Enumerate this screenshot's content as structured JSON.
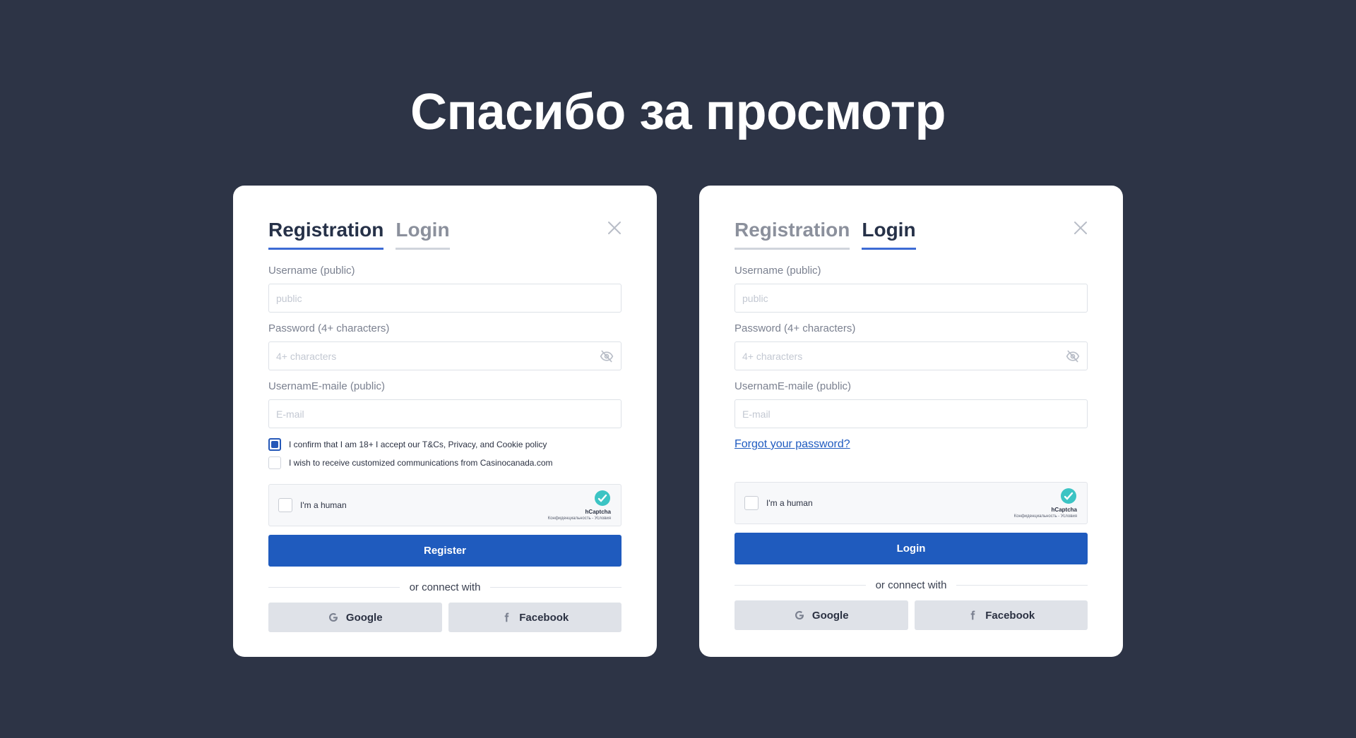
{
  "heading": "Спасибо за просмотр",
  "colors": {
    "background": "#2d3446",
    "primary": "#1f5bbe",
    "tab_active_underline": "#3d6bd4",
    "link": "#1f5bc0"
  },
  "registration_card": {
    "tabs": {
      "registration": "Registration",
      "login": "Login",
      "active": "registration"
    },
    "username_label": "Username (public)",
    "username_placeholder": "public",
    "password_label": "Password (4+ characters)",
    "password_placeholder": "4+ characters",
    "email_label": "UsernamE-maile (public)",
    "email_placeholder": "E-mail",
    "checkbox_terms": {
      "text": "I confirm that I am 18+ I accept our T&Cs, Privacy, and Cookie policy",
      "checked": true
    },
    "checkbox_comms": {
      "text": "I wish to receive customized communications from Casinocanada.com",
      "checked": false
    },
    "captcha": {
      "label": "I'm a human",
      "brand": "hCaptcha",
      "links": "Конфиденциальность - Условия"
    },
    "submit_label": "Register",
    "divider_text": "or connect with",
    "google_label": "Google",
    "facebook_label": "Facebook"
  },
  "login_card": {
    "tabs": {
      "registration": "Registration",
      "login": "Login",
      "active": "login"
    },
    "username_label": "Username (public)",
    "username_placeholder": "public",
    "password_label": "Password (4+ characters)",
    "password_placeholder": "4+ characters",
    "email_label": "UsernamE-maile (public)",
    "email_placeholder": "E-mail",
    "forgot_link": "Forgot your password?",
    "captcha": {
      "label": "I'm a human",
      "brand": "hCaptcha",
      "links": "Конфиденциальность - Условия"
    },
    "submit_label": "Login",
    "divider_text": "or connect with",
    "google_label": "Google",
    "facebook_label": "Facebook"
  }
}
